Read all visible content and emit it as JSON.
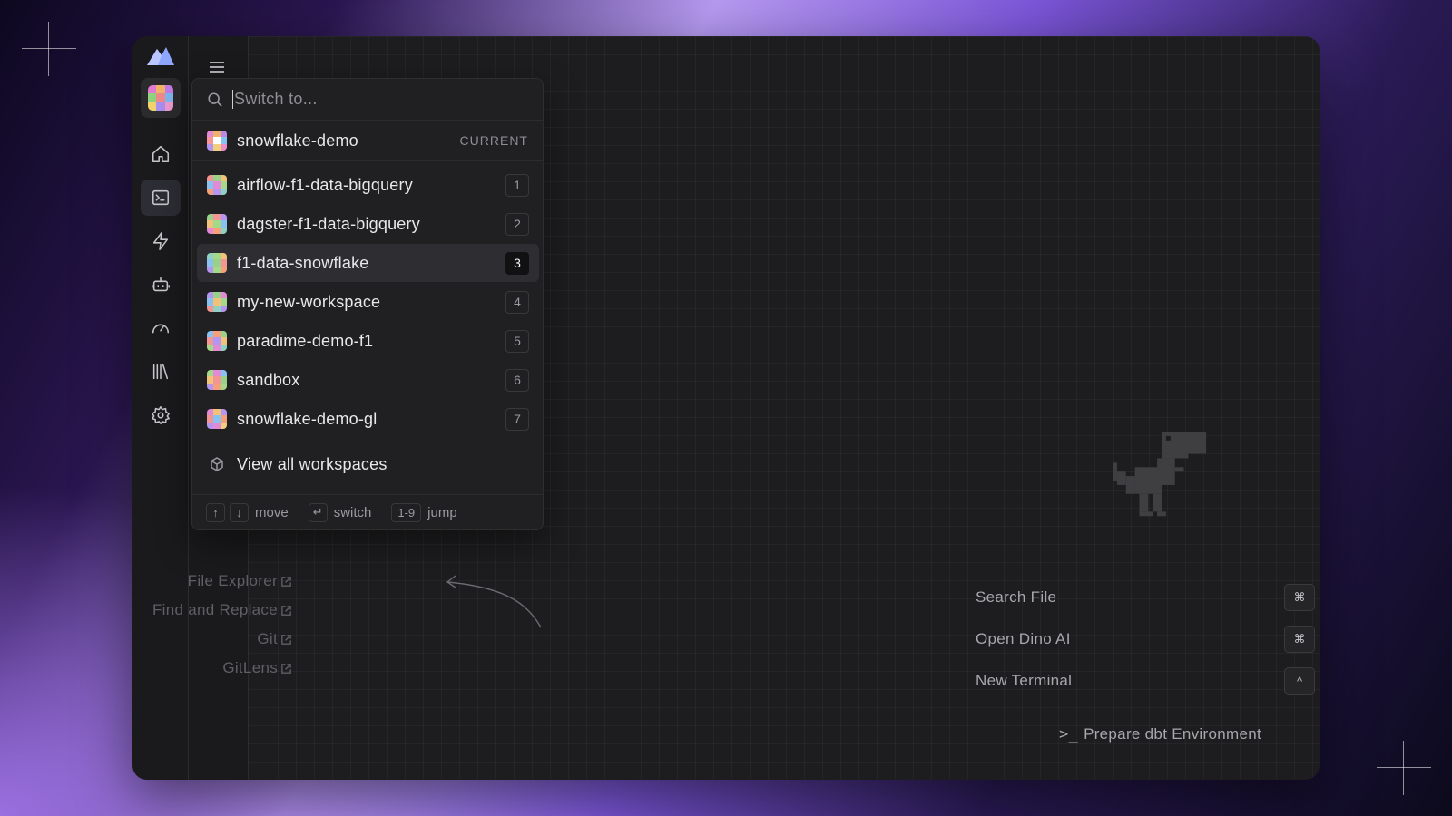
{
  "search": {
    "placeholder": "Switch to..."
  },
  "current_workspace": {
    "name": "snowflake-demo",
    "badge": "CURRENT"
  },
  "workspaces": [
    {
      "name": "airflow-f1-data-bigquery",
      "key": "1"
    },
    {
      "name": "dagster-f1-data-bigquery",
      "key": "2"
    },
    {
      "name": "f1-data-snowflake",
      "key": "3"
    },
    {
      "name": "my-new-workspace",
      "key": "4"
    },
    {
      "name": "paradime-demo-f1",
      "key": "5"
    },
    {
      "name": "sandbox",
      "key": "6"
    },
    {
      "name": "snowflake-demo-gl",
      "key": "7"
    }
  ],
  "view_all": "View all workspaces",
  "footer": {
    "up": "↑",
    "down": "↓",
    "move": "move",
    "enter": "↵",
    "switch": "switch",
    "range": "1-9",
    "jump": "jump"
  },
  "links": [
    "File Explorer",
    "Find and Replace",
    "Git",
    "GitLens"
  ],
  "shortcuts": [
    {
      "label": "Search File",
      "key": "⌘"
    },
    {
      "label": "Open Dino AI",
      "key": "⌘"
    },
    {
      "label": "New Terminal",
      "key": "^"
    }
  ],
  "prepare": {
    "prompt": ">_",
    "label": "Prepare dbt Environment"
  },
  "colors": {
    "accent_selected": "#2e2e32",
    "window_bg": "#1d1d1f",
    "rail_bg": "#1a1a1c"
  },
  "icons": [
    "logo-icon",
    "workspace-icon",
    "home-icon",
    "terminal-icon",
    "bolt-icon",
    "robot-icon",
    "gauge-icon",
    "library-icon",
    "gear-icon",
    "menu-icon",
    "search-icon",
    "cube-icon",
    "external-link-icon",
    "dino-icon"
  ]
}
